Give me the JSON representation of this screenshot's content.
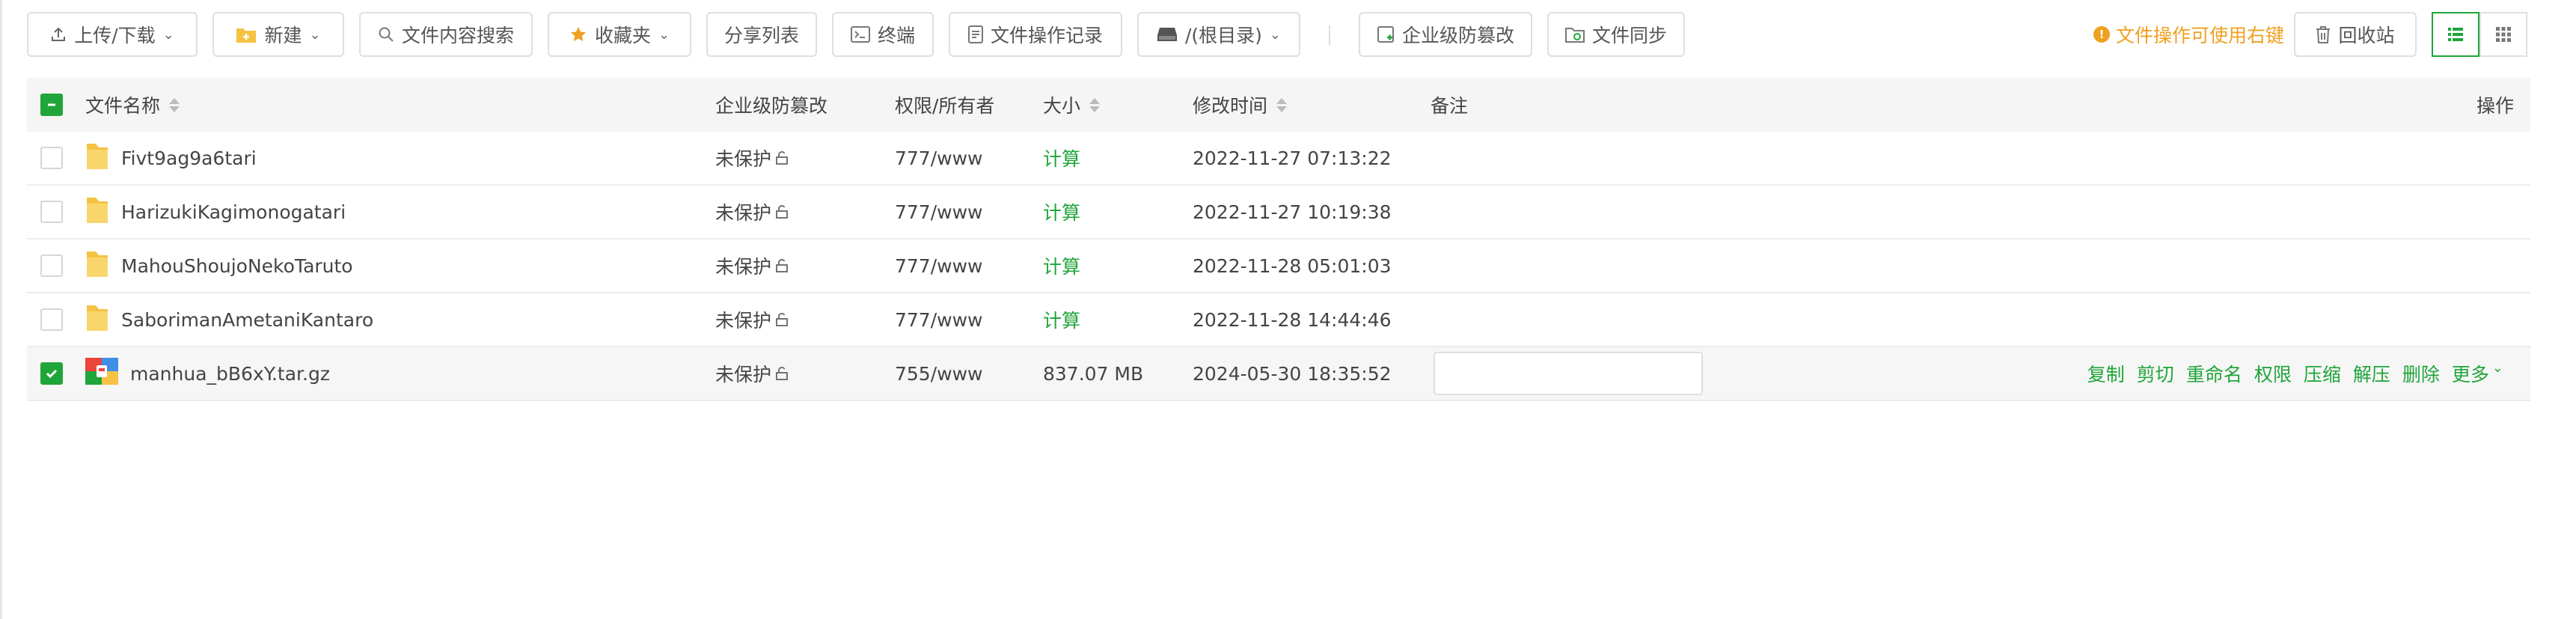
{
  "toolbar": {
    "upload_download": "上传/下载",
    "new": "新建",
    "search_content": "文件内容搜索",
    "favorites": "收藏夹",
    "share_list": "分享列表",
    "terminal": "终端",
    "file_log": "文件操作记录",
    "path": "/(根目录)",
    "tamper_protect": "企业级防篡改",
    "file_sync": "文件同步",
    "tip": "文件操作可使用右键",
    "recycle_bin": "回收站"
  },
  "table": {
    "headers": {
      "name": "文件名称",
      "tamper": "企业级防篡改",
      "perm": "权限/所有者",
      "size": "大小",
      "mtime": "修改时间",
      "remark": "备注",
      "ops": "操作"
    },
    "rows": [
      {
        "name": "Fivt9ag9a6tari",
        "type": "folder",
        "tamper": "未保护",
        "perm": "777/www",
        "size": "计算",
        "mtime": "2022-11-27 07:13:22",
        "selected": false
      },
      {
        "name": "HarizukiKagimonogatari",
        "type": "folder",
        "tamper": "未保护",
        "perm": "777/www",
        "size": "计算",
        "mtime": "2022-11-27 10:19:38",
        "selected": false
      },
      {
        "name": "MahouShoujoNekoTaruto",
        "type": "folder",
        "tamper": "未保护",
        "perm": "777/www",
        "size": "计算",
        "mtime": "2022-11-28 05:01:03",
        "selected": false
      },
      {
        "name": "SaborimanAmetaniKantaro",
        "type": "folder",
        "tamper": "未保护",
        "perm": "777/www",
        "size": "计算",
        "mtime": "2022-11-28 14:44:46",
        "selected": false
      },
      {
        "name": "manhua_bB6xY.tar.gz",
        "type": "archive",
        "tamper": "未保护",
        "perm": "755/www",
        "size": "837.07 MB",
        "mtime": "2024-05-30 18:35:52",
        "selected": true
      }
    ],
    "row_actions": [
      "复制",
      "剪切",
      "重命名",
      "权限",
      "压缩",
      "解压",
      "删除",
      "更多"
    ]
  },
  "colors": {
    "accent": "#20a53a",
    "warning": "#f0a020",
    "folder": "#f5c242"
  }
}
